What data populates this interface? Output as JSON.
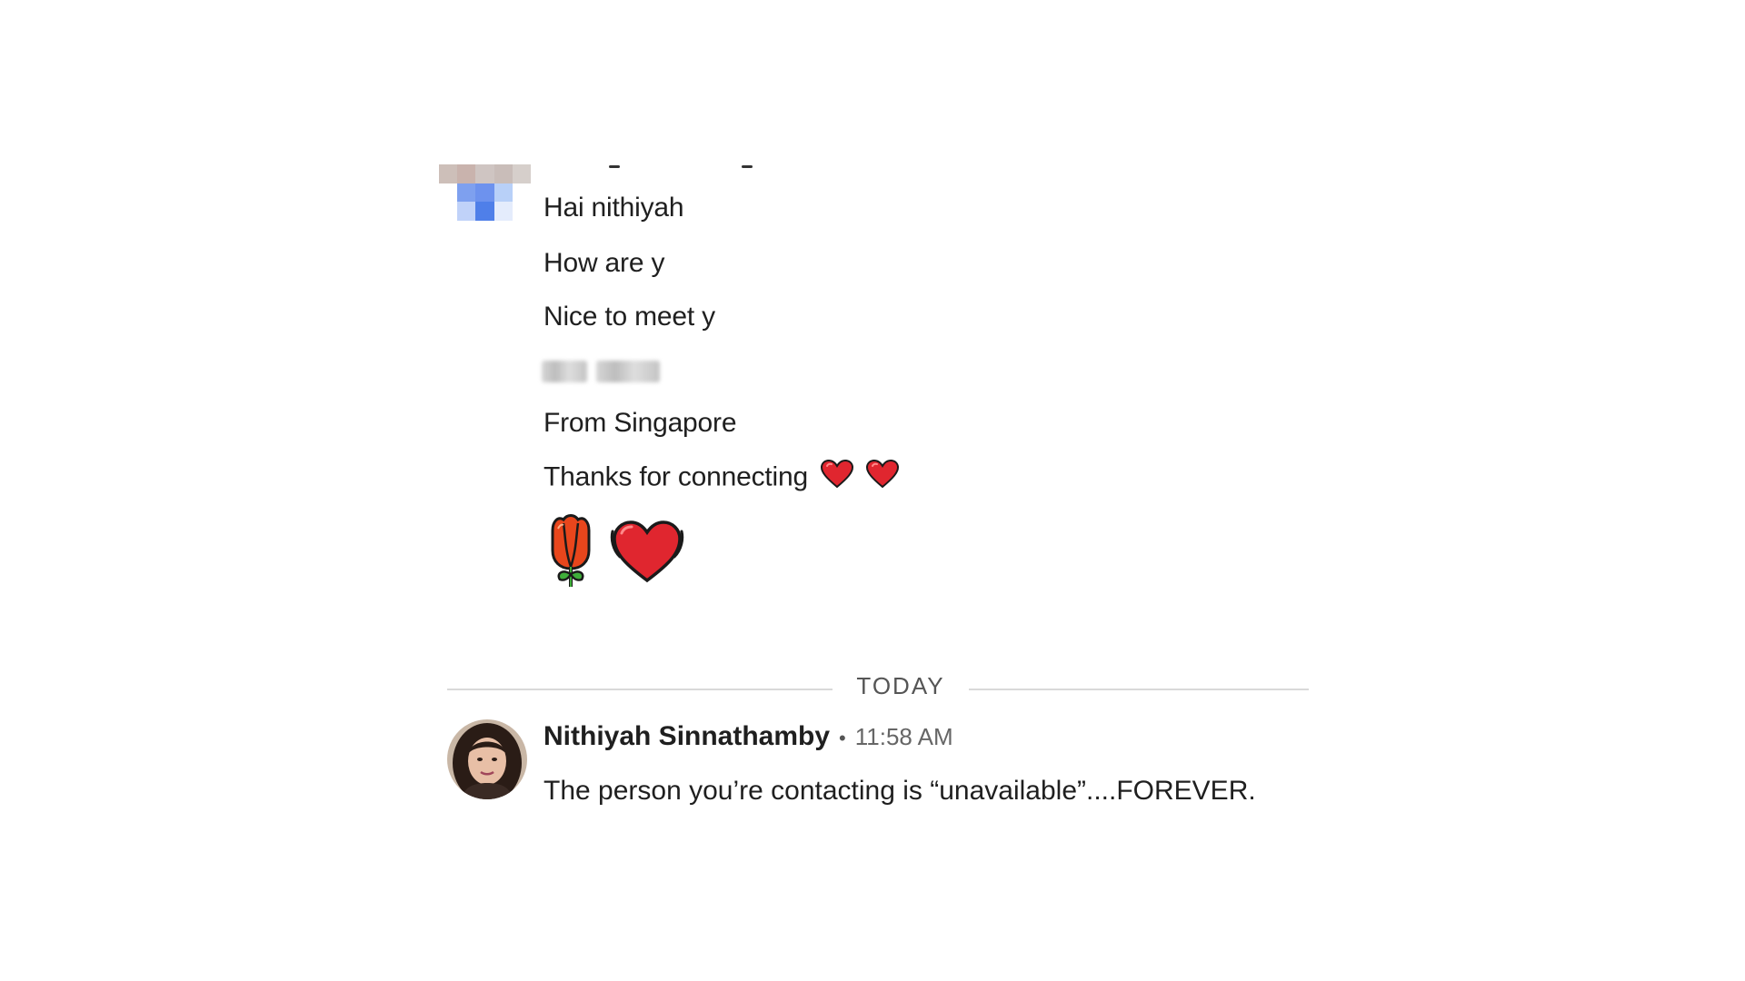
{
  "thread": {
    "earlier_messages": {
      "lines": [
        "Hai nithiyah",
        "How are y",
        "Nice to meet y",
        "From Singapore",
        "Thanks for connecting"
      ],
      "thanks_emoji": "heart-icon",
      "sticker_icons": [
        "rose-icon",
        "heart-hands-icon"
      ]
    },
    "divider_label": "TODAY",
    "latest": {
      "author": "Nithiyah Sinnathamby",
      "separator": "•",
      "time": "11:58 AM",
      "text": "The person you’re contacting is “unavailable”....FOREVER."
    }
  },
  "colors": {
    "heart_red": "#e0262f",
    "rose_red": "#e8461c",
    "leaf_green": "#3fae3a",
    "divider": "#d9d9d9"
  }
}
